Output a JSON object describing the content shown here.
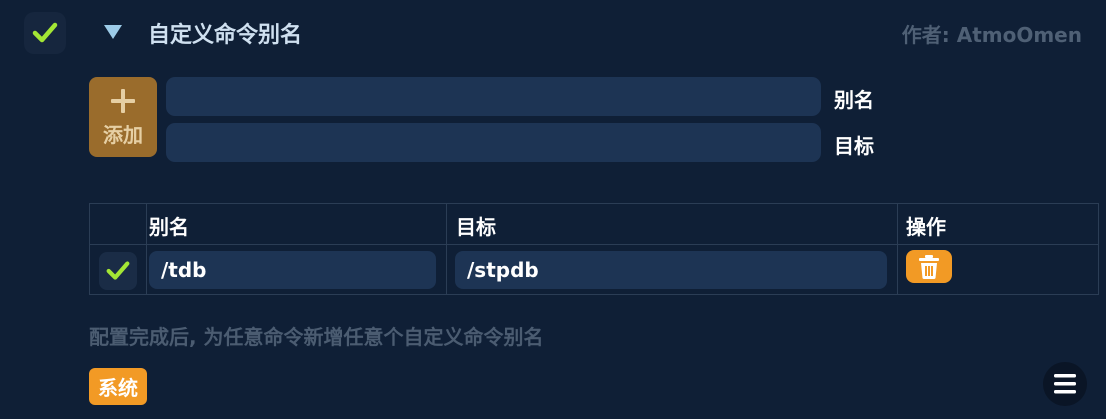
{
  "header": {
    "title": "自定义命令别名",
    "author": "作者: AtmoOmen",
    "enabled_icon": "check-icon",
    "collapse_icon": "triangle-down-icon"
  },
  "add_form": {
    "add_label": "添加",
    "add_icon": "plus-icon",
    "alias_label": "别名",
    "target_label": "目标",
    "alias_value": "",
    "target_value": ""
  },
  "table": {
    "headers": [
      "",
      "别名",
      "目标",
      "操作"
    ],
    "rows": [
      {
        "enabled": true,
        "alias": "/tdb",
        "target": "/stpdb",
        "action_icon": "trash-icon"
      }
    ]
  },
  "hint": "配置完成后, 为任意命令新增任意个自定义命令别名",
  "badge": "系统",
  "menu_icon": "hamburger-menu-icon",
  "colors": {
    "background": "#0f1f36",
    "input": "#1d3454",
    "accent_orange": "#f29a25",
    "add_button": "#9a6c2c",
    "check_green": "#a3e635",
    "muted_text": "#4b5c71"
  }
}
